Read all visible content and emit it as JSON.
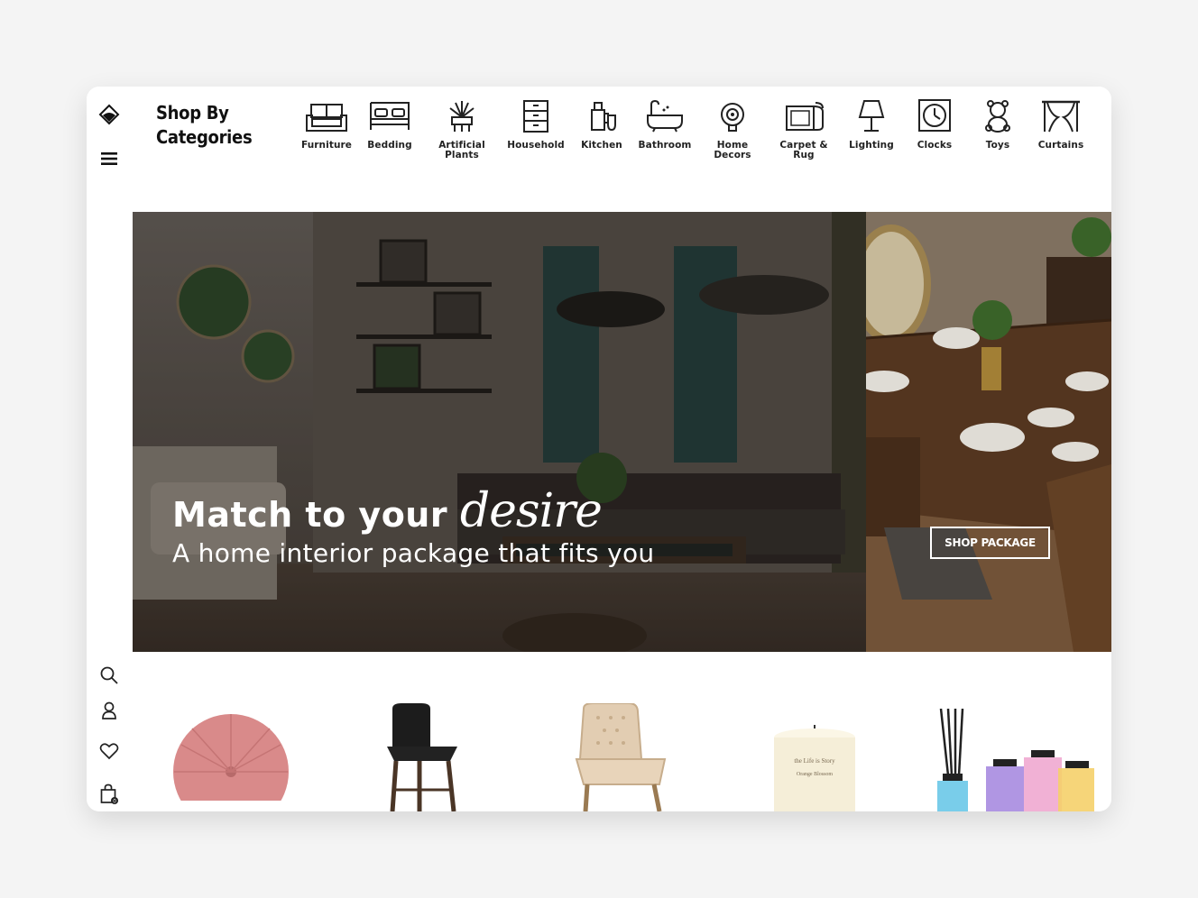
{
  "sidebar": {
    "icons": [
      "logo-icon",
      "menu-icon",
      "search-icon",
      "user-icon",
      "heart-icon",
      "bag-icon"
    ]
  },
  "header": {
    "title": "Shop By\nCategories"
  },
  "categories": [
    {
      "label": "Furniture",
      "icon": "sofa-icon"
    },
    {
      "label": "Bedding",
      "icon": "bed-icon"
    },
    {
      "label": "Artificial\nPlants",
      "icon": "plant-icon"
    },
    {
      "label": "Household",
      "icon": "drawer-icon"
    },
    {
      "label": "Kitchen",
      "icon": "kitchen-icon"
    },
    {
      "label": "Bathroom",
      "icon": "bathtub-icon"
    },
    {
      "label": "Home\nDecors",
      "icon": "shell-icon"
    },
    {
      "label": "Carpet &\nRug",
      "icon": "rug-icon"
    },
    {
      "label": "Lighting",
      "icon": "lamp-icon"
    },
    {
      "label": "Clocks",
      "icon": "clock-icon"
    },
    {
      "label": "Toys",
      "icon": "teddy-icon"
    },
    {
      "label": "Curtains",
      "icon": "curtains-icon"
    }
  ],
  "hero": {
    "headline": "Match to your",
    "headline_script": "desire",
    "subheadline": "A home interior package that fits you",
    "cta_label": "SHOP PACKAGE"
  },
  "products": [
    "pink-cushion",
    "black-bar-stool",
    "beige-dining-chair",
    "candle",
    "reed-diffuser"
  ]
}
